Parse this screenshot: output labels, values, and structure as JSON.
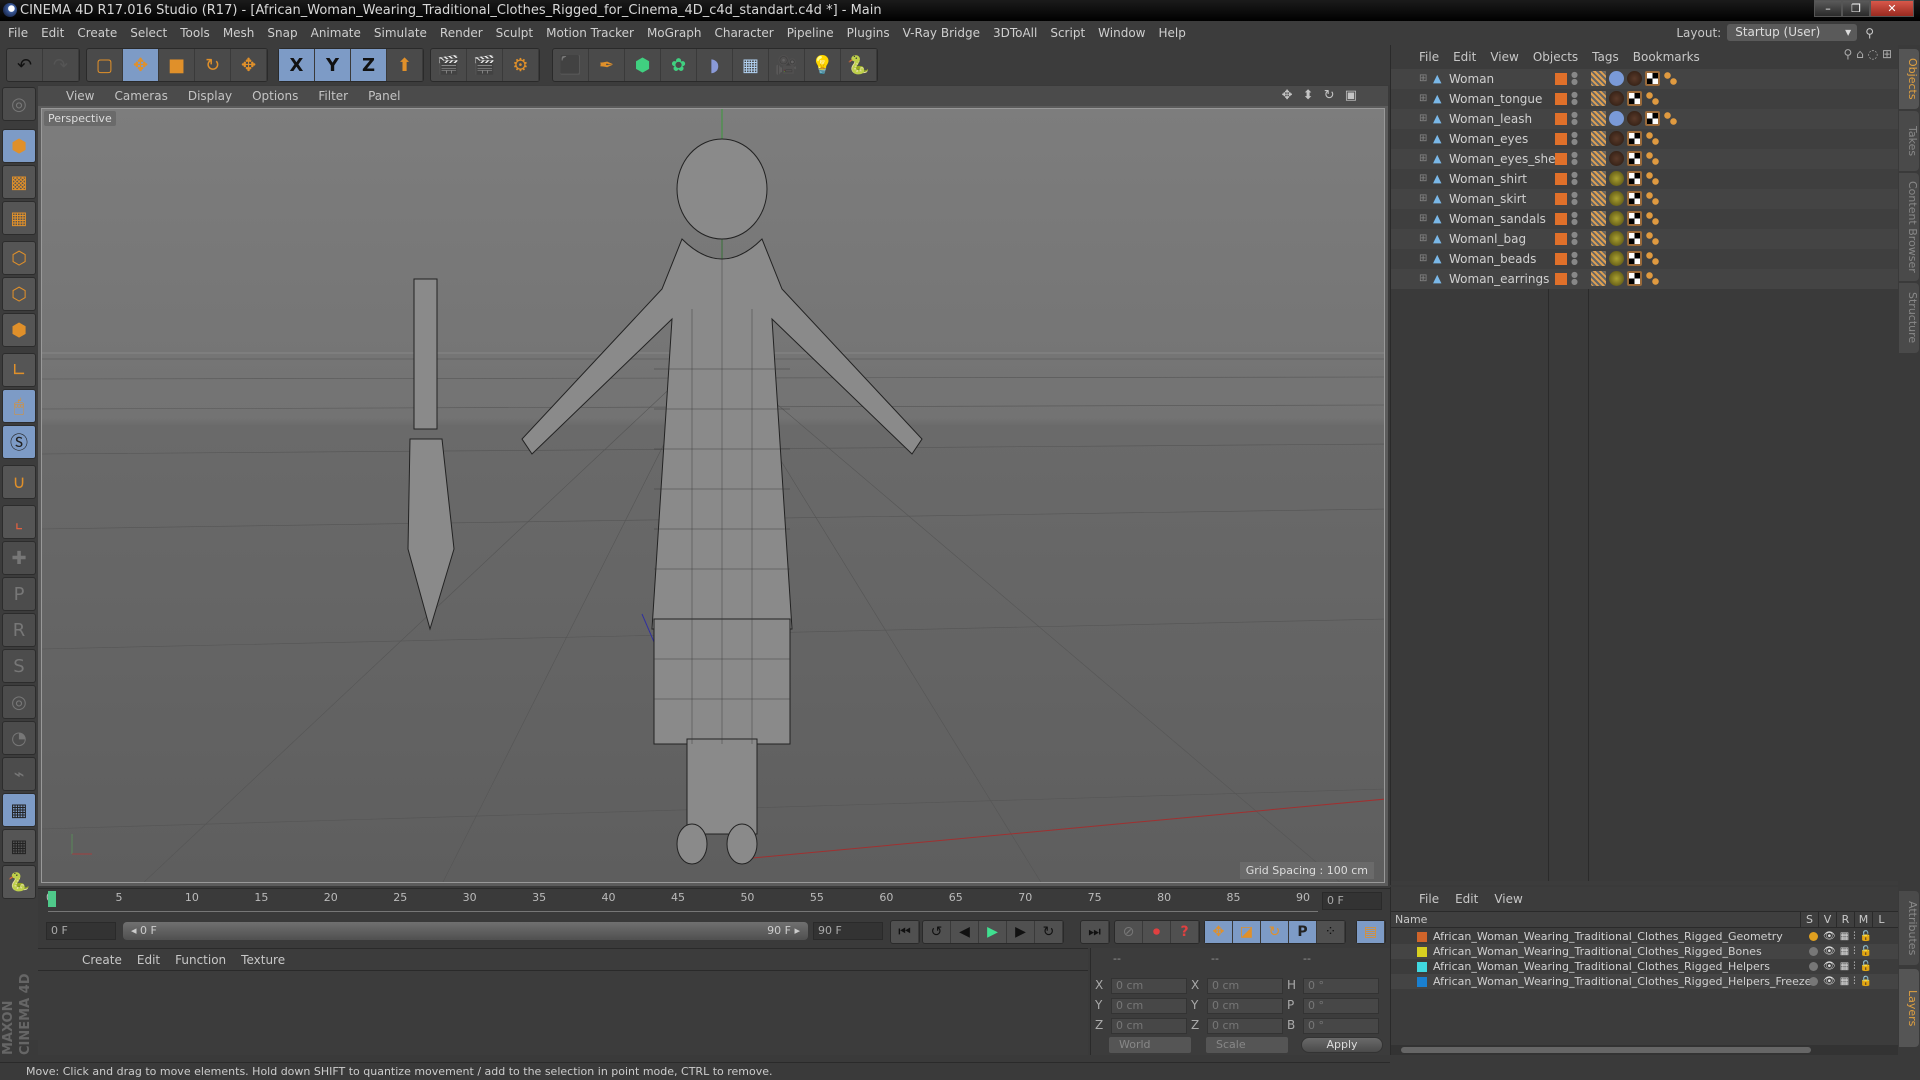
{
  "window": {
    "title": "CINEMA 4D R17.016 Studio (R17) - [African_Woman_Wearing_Traditional_Clothes_Rigged_for_Cinema_4D_c4d_standart.c4d *] - Main",
    "minimize": "–",
    "restore": "❐",
    "close": "✕"
  },
  "menubar": [
    "File",
    "Edit",
    "Create",
    "Select",
    "Tools",
    "Mesh",
    "Snap",
    "Animate",
    "Simulate",
    "Render",
    "Sculpt",
    "Motion Tracker",
    "MoGraph",
    "Character",
    "Pipeline",
    "Plugins",
    "V-Ray Bridge",
    "3DToAll",
    "Script",
    "Window",
    "Help"
  ],
  "layout": {
    "label": "Layout:",
    "value": "Startup (User)"
  },
  "toolbar": {
    "undo": "↶",
    "redo": "↷",
    "live_select": "▢",
    "move": "✥",
    "scale": "■",
    "rotate": "↻",
    "move2": "✥",
    "axis_x": "X",
    "axis_y": "Y",
    "axis_z": "Z",
    "coord_system": "⬆",
    "render_view": "🎬",
    "render_picture": "🎬",
    "render_settings": "⚙",
    "cube": "⬛",
    "pen": "✒",
    "subdivision": "⬢",
    "cloner": "✿",
    "deformer": "◗",
    "floor": "▦",
    "camera": "🎥",
    "light": "💡",
    "python": "🐍"
  },
  "left_tools": [
    "globe",
    "model",
    "texture",
    "workplane",
    "points",
    "edges",
    "polygons",
    "axis",
    "tweak",
    "solo",
    "snap",
    "axis-lock",
    "add-joint",
    "ik-p",
    "ik-r",
    "ik-psr",
    "ik-target",
    "ik-pole",
    "ik-chain",
    "lock-workplane",
    "workplane-cycle",
    "python"
  ],
  "brand": "MAXON CINEMA 4D",
  "viewport": {
    "menu": [
      "View",
      "Cameras",
      "Display",
      "Options",
      "Filter",
      "Panel"
    ],
    "camera_label": "Perspective",
    "grid_spacing": "Grid Spacing : 100 cm",
    "nav_icons": "✥ ⬍ ↻ ▣"
  },
  "timeline": {
    "ticks": [
      0,
      5,
      10,
      15,
      20,
      25,
      30,
      35,
      40,
      45,
      50,
      55,
      60,
      65,
      70,
      75,
      80,
      85,
      90
    ],
    "min": 0,
    "max": 90,
    "current_frame": 0,
    "current_frame_label": "0 F",
    "start_field": "0 F",
    "range_start": "◂ 0 F",
    "range_end": "90 F ▸",
    "end_field": "90 F"
  },
  "playback": {
    "first": "⏮",
    "prev_key": "↺",
    "prev": "◀",
    "play": "▶",
    "next": "▶",
    "next_key": "↻",
    "last": "⏭",
    "autokey": "⊘",
    "record": "⏺",
    "help": "?",
    "pos": "✥",
    "scl": "◪",
    "rot": "↻",
    "param": "P",
    "pla": "⁘",
    "timeline": "▤"
  },
  "material_manager": {
    "menu": [
      "Create",
      "Edit",
      "Function",
      "Texture"
    ]
  },
  "coordinates": {
    "headers": [
      "--",
      "--",
      "--"
    ],
    "rows": [
      {
        "l1": "X",
        "v1": "0 cm",
        "l2": "X",
        "v2": "0 cm",
        "l3": "H",
        "v3": "0 °"
      },
      {
        "l1": "Y",
        "v1": "0 cm",
        "l2": "Y",
        "v2": "0 cm",
        "l3": "P",
        "v3": "0 °"
      },
      {
        "l1": "Z",
        "v1": "0 cm",
        "l2": "Z",
        "v2": "0 cm",
        "l3": "B",
        "v3": "0 °"
      }
    ],
    "space": "World",
    "mode": "Scale",
    "apply": "Apply"
  },
  "status": "Move: Click and drag to move elements. Hold down SHIFT to quantize movement / add to the selection in point mode, CTRL to remove.",
  "object_manager": {
    "menu": [
      "File",
      "Edit",
      "View",
      "Objects",
      "Tags",
      "Bookmarks"
    ],
    "objects": [
      {
        "name": "Woman",
        "tags": [
          "phong",
          "ik",
          "mat-dark",
          "uv",
          "sel"
        ]
      },
      {
        "name": "Woman_tongue",
        "tags": [
          "phong",
          "mat-dark",
          "uv",
          "sel"
        ]
      },
      {
        "name": "Woman_leash",
        "tags": [
          "phong",
          "ik",
          "mat-dark",
          "uv",
          "sel"
        ]
      },
      {
        "name": "Woman_eyes",
        "tags": [
          "phong",
          "mat-dark",
          "uv",
          "sel"
        ]
      },
      {
        "name": "Woman_eyes_shell",
        "tags": [
          "phong",
          "mat-dark",
          "uv",
          "sel"
        ]
      },
      {
        "name": "Woman_shirt",
        "tags": [
          "phong",
          "mat-olive",
          "uv",
          "sel"
        ]
      },
      {
        "name": "Woman_skirt",
        "tags": [
          "phong",
          "mat-olive",
          "uv",
          "sel"
        ]
      },
      {
        "name": "Woman_sandals",
        "tags": [
          "phong",
          "mat-olive",
          "uv",
          "sel"
        ]
      },
      {
        "name": "Womanl_bag",
        "tags": [
          "phong",
          "mat-olive",
          "uv",
          "sel"
        ]
      },
      {
        "name": "Woman_beads",
        "tags": [
          "phong",
          "mat-olive",
          "uv",
          "sel"
        ]
      },
      {
        "name": "Woman_earrings",
        "tags": [
          "phong",
          "mat-olive",
          "uv",
          "sel"
        ]
      }
    ],
    "layer_color": "#e0702a"
  },
  "side_tabs": [
    "Objects",
    "Takes",
    "Content Browser",
    "Structure"
  ],
  "layer_manager": {
    "menu": [
      "File",
      "Edit",
      "View"
    ],
    "header_name": "Name",
    "columns": [
      "S",
      "V",
      "R",
      "M",
      "L"
    ],
    "layers": [
      {
        "name": "African_Woman_Wearing_Traditional_Clothes_Rigged_Geometry",
        "color": "#d0642a",
        "solo": true
      },
      {
        "name": "African_Woman_Wearing_Traditional_Clothes_Rigged_Bones",
        "color": "#d8d020",
        "solo": false
      },
      {
        "name": "African_Woman_Wearing_Traditional_Clothes_Rigged_Helpers",
        "color": "#40d8e0",
        "solo": false
      },
      {
        "name": "African_Woman_Wearing_Traditional_Clothes_Rigged_Helpers_Freeze",
        "color": "#1a80d0",
        "solo": false
      }
    ]
  },
  "layer_side_tabs": [
    "Attributes",
    "Layers"
  ]
}
